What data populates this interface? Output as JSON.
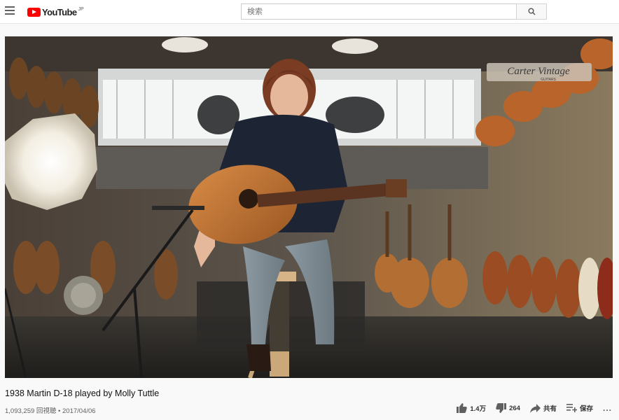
{
  "header": {
    "logo_text": "YouTube",
    "logo_region": "JP",
    "search_placeholder": "検索"
  },
  "video": {
    "title": "1938 Martin D-18 played by Molly Tuttle",
    "views": "1,093,259 回視聴",
    "separator": "•",
    "date": "2017/04/06",
    "store_sign_line1": "Carter Vintage",
    "store_sign_line2": "GUITARS"
  },
  "actions": {
    "like_count": "1.4万",
    "dislike_count": "264",
    "share_label": "共有",
    "save_label": "保存",
    "more_label": "..."
  },
  "colors": {
    "brand_red": "#ff0000",
    "icon_gray": "#606060"
  }
}
